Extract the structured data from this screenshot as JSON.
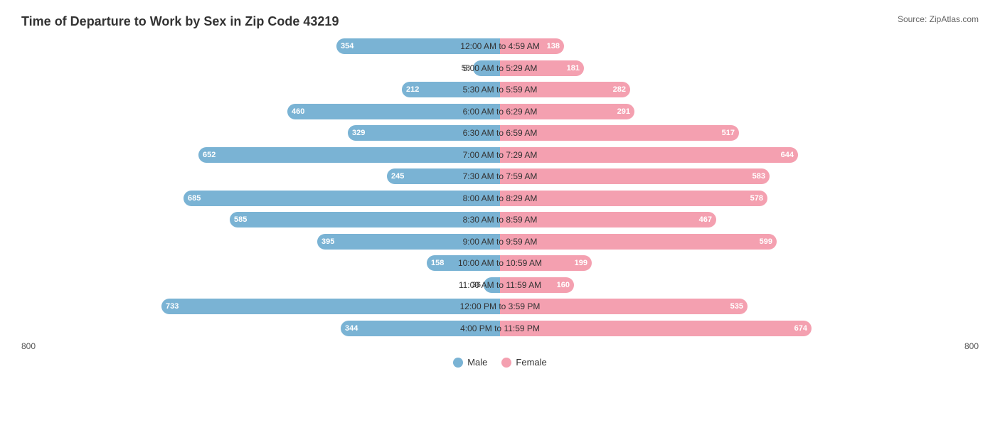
{
  "title": "Time of Departure to Work by Sex in Zip Code 43219",
  "source": "Source: ZipAtlas.com",
  "axis_min": "800",
  "axis_max": "800",
  "legend": {
    "male_label": "Male",
    "female_label": "Female",
    "male_color": "#7ab3d4",
    "female_color": "#f4a0b0"
  },
  "max_value": 800,
  "rows": [
    {
      "label": "12:00 AM to 4:59 AM",
      "male": 354,
      "female": 138
    },
    {
      "label": "5:00 AM to 5:29 AM",
      "male": 58,
      "female": 181
    },
    {
      "label": "5:30 AM to 5:59 AM",
      "male": 212,
      "female": 282
    },
    {
      "label": "6:00 AM to 6:29 AM",
      "male": 460,
      "female": 291
    },
    {
      "label": "6:30 AM to 6:59 AM",
      "male": 329,
      "female": 517
    },
    {
      "label": "7:00 AM to 7:29 AM",
      "male": 652,
      "female": 644
    },
    {
      "label": "7:30 AM to 7:59 AM",
      "male": 245,
      "female": 583
    },
    {
      "label": "8:00 AM to 8:29 AM",
      "male": 685,
      "female": 578
    },
    {
      "label": "8:30 AM to 8:59 AM",
      "male": 585,
      "female": 467
    },
    {
      "label": "9:00 AM to 9:59 AM",
      "male": 395,
      "female": 599
    },
    {
      "label": "10:00 AM to 10:59 AM",
      "male": 158,
      "female": 199
    },
    {
      "label": "11:00 AM to 11:59 AM",
      "male": 36,
      "female": 160
    },
    {
      "label": "12:00 PM to 3:59 PM",
      "male": 733,
      "female": 535
    },
    {
      "label": "4:00 PM to 11:59 PM",
      "male": 344,
      "female": 674
    }
  ]
}
